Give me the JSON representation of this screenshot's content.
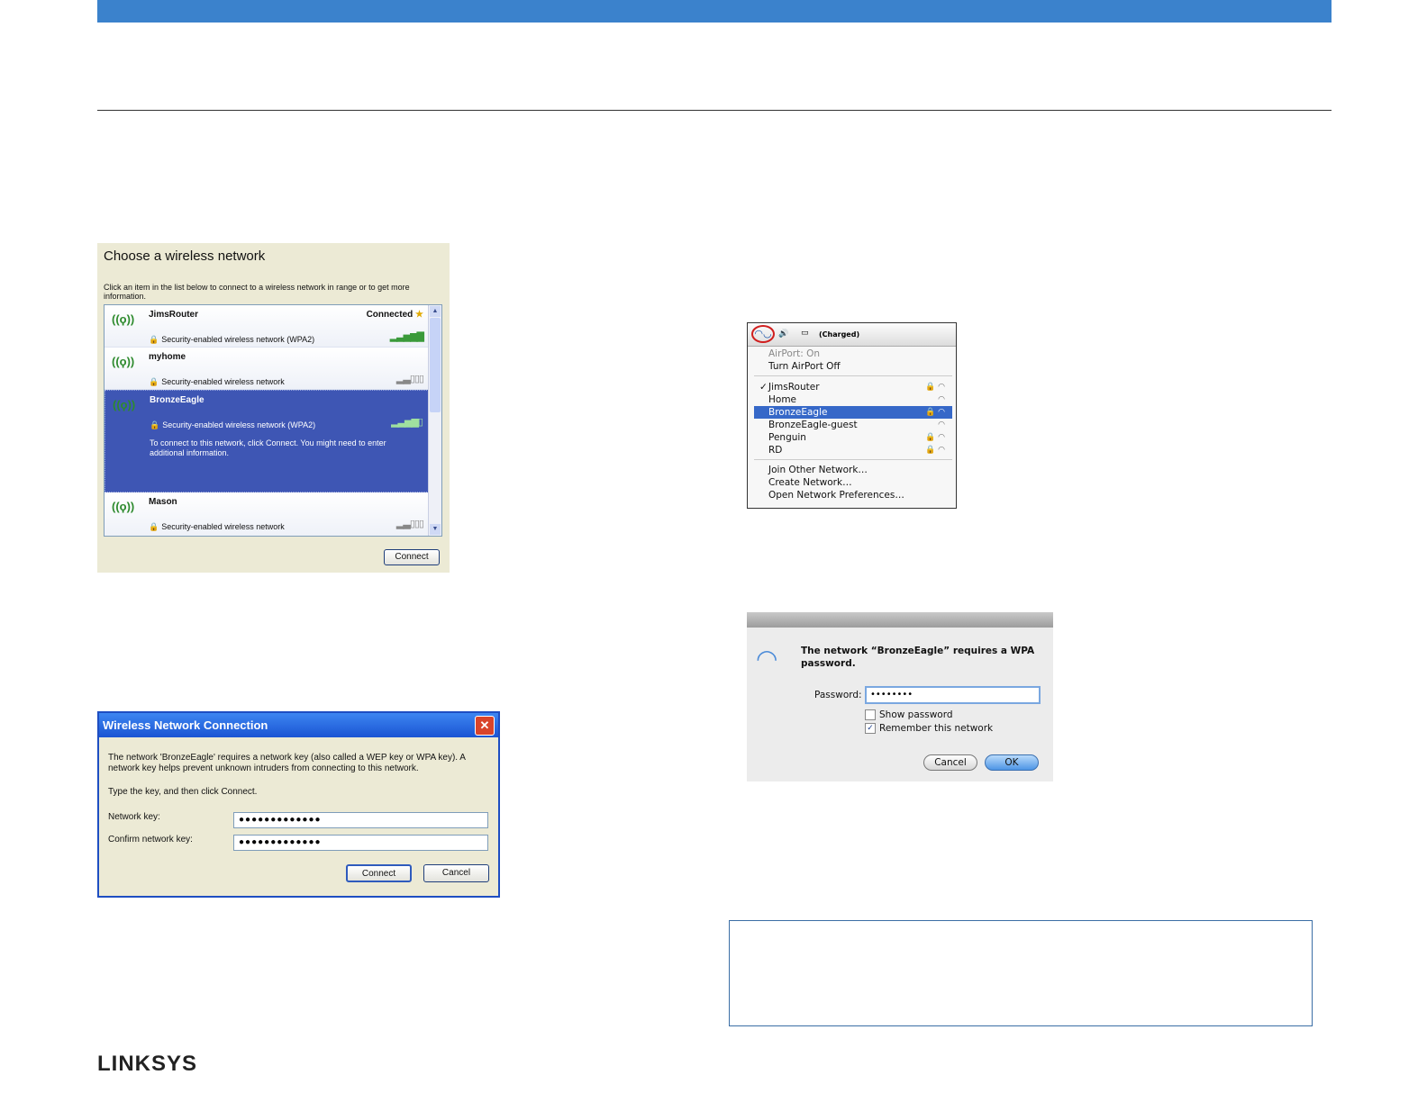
{
  "brand": {
    "logo": "LINKSYS"
  },
  "xp_choose": {
    "title": "Choose a wireless network",
    "description": "Click an item in the list below to connect to a wireless network in range or to get more information.",
    "networks": [
      {
        "name": "JimsRouter",
        "security": "Security-enabled wireless network (WPA2)",
        "status": "Connected",
        "signal": 5
      },
      {
        "name": "myhome",
        "security": "Security-enabled wireless network",
        "status": "",
        "signal": 2
      },
      {
        "name": "BronzeEagle",
        "security": "Security-enabled wireless network (WPA2)",
        "status": "",
        "signal": 4,
        "note": "To connect to this network, click Connect. You might need to enter additional information."
      },
      {
        "name": "Mason",
        "security": "Security-enabled wireless network",
        "status": "",
        "signal": 2
      }
    ],
    "connect_label": "Connect"
  },
  "xp_dialog": {
    "title": "Wireless Network Connection",
    "message": "The network 'BronzeEagle' requires a network key (also called a WEP key or WPA key). A network key helps prevent unknown intruders from connecting to this network.",
    "instruction": "Type the key, and then click Connect.",
    "key_label": "Network key:",
    "key_value": "●●●●●●●●●●●●●",
    "confirm_label": "Confirm network key:",
    "confirm_value": "●●●●●●●●●●●●●",
    "connect_label": "Connect",
    "cancel_label": "Cancel"
  },
  "mac_menu": {
    "battery_text": "(Charged)",
    "airport_status": "AirPort: On",
    "turn_off": "Turn AirPort Off",
    "networks": [
      {
        "name": "JimsRouter",
        "checked": true,
        "locked": true
      },
      {
        "name": "Home",
        "checked": false,
        "locked": false
      },
      {
        "name": "BronzeEagle",
        "checked": false,
        "locked": true,
        "selected": true
      },
      {
        "name": "BronzeEagle-guest",
        "checked": false,
        "locked": false
      },
      {
        "name": "Penguin",
        "checked": false,
        "locked": true
      },
      {
        "name": "RD",
        "checked": false,
        "locked": true
      }
    ],
    "join_other": "Join Other Network…",
    "create": "Create Network…",
    "open_prefs": "Open Network Preferences…"
  },
  "mac_dialog": {
    "message": "The network “BronzeEagle” requires a WPA password.",
    "password_label": "Password:",
    "password_value": "••••••••",
    "show_password": "Show password",
    "remember": "Remember this network",
    "cancel_label": "Cancel",
    "ok_label": "OK"
  }
}
